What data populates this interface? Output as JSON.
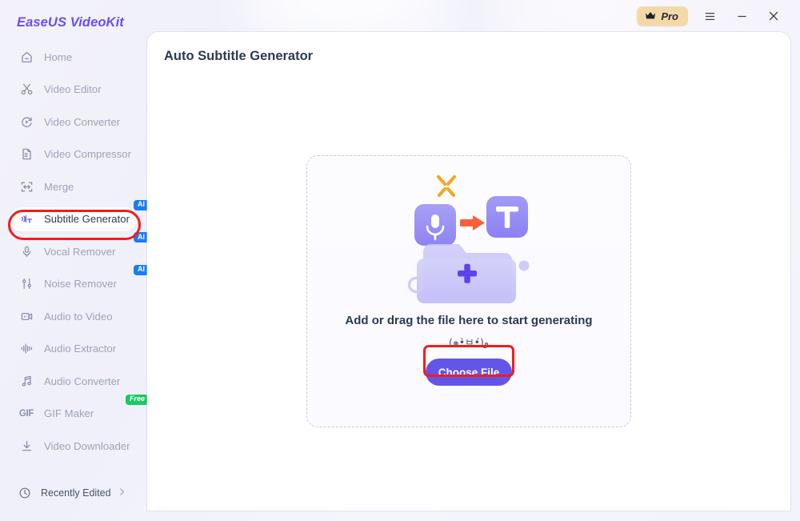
{
  "window": {
    "logo": "EaseUS VideoKit",
    "pro_label": "Pro",
    "pro_icon": "crown-icon",
    "menu_icon": "hamburger-menu-icon",
    "minimize_icon": "minimize-icon",
    "close_icon": "close-icon"
  },
  "sidebar": {
    "items": [
      {
        "label": "Home",
        "icon": "home-icon",
        "badge": null,
        "active": false
      },
      {
        "label": "Video Editor",
        "icon": "scissors-icon",
        "badge": null,
        "active": false
      },
      {
        "label": "Video Converter",
        "icon": "convert-circle-icon",
        "badge": null,
        "active": false
      },
      {
        "label": "Video Compressor",
        "icon": "document-compress-icon",
        "badge": null,
        "active": false
      },
      {
        "label": "Merge",
        "icon": "merge-arrows-icon",
        "badge": null,
        "active": false
      },
      {
        "label": "Subtitle Generator",
        "icon": "subtitle-wave-icon",
        "badge": "AI",
        "active": true
      },
      {
        "label": "Vocal Remover",
        "icon": "microphone-icon",
        "badge": "AI",
        "active": false
      },
      {
        "label": "Noise Remover",
        "icon": "noise-sliders-icon",
        "badge": "AI",
        "active": false
      },
      {
        "label": "Audio to Video",
        "icon": "video-camera-icon",
        "badge": null,
        "active": false
      },
      {
        "label": "Audio Extractor",
        "icon": "waveform-icon",
        "badge": null,
        "active": false
      },
      {
        "label": "Audio Converter",
        "icon": "music-note-icon",
        "badge": null,
        "active": false
      },
      {
        "label": "GIF Maker",
        "icon": "gif-text-icon",
        "badge": "Free",
        "active": false
      },
      {
        "label": "Video Downloader",
        "icon": "download-icon",
        "badge": null,
        "active": false
      }
    ],
    "recently_edited": {
      "label": "Recently Edited",
      "icon": "clock-icon",
      "chevron": "chevron-right-icon"
    }
  },
  "main": {
    "title": "Auto Subtitle Generator",
    "dropzone": {
      "heading": "Add or drag the file here to start generating",
      "emoticon": "(๑•̀ㅂ•́)و",
      "button_label": "Choose File",
      "illustration": "mic-to-text-folder-illustration"
    }
  },
  "annotations": {
    "highlight_color": "#f41b1b",
    "targets": [
      "sidebar-item-subtitle-generator",
      "choose-file-button"
    ]
  },
  "colors": {
    "accent": "#6355e8",
    "brand": "#6a4df5",
    "pro_badge": "#f4d9a8",
    "ai_badge": "#1a7cf5",
    "free_badge": "#18c964",
    "annotation": "#f41b1b"
  }
}
